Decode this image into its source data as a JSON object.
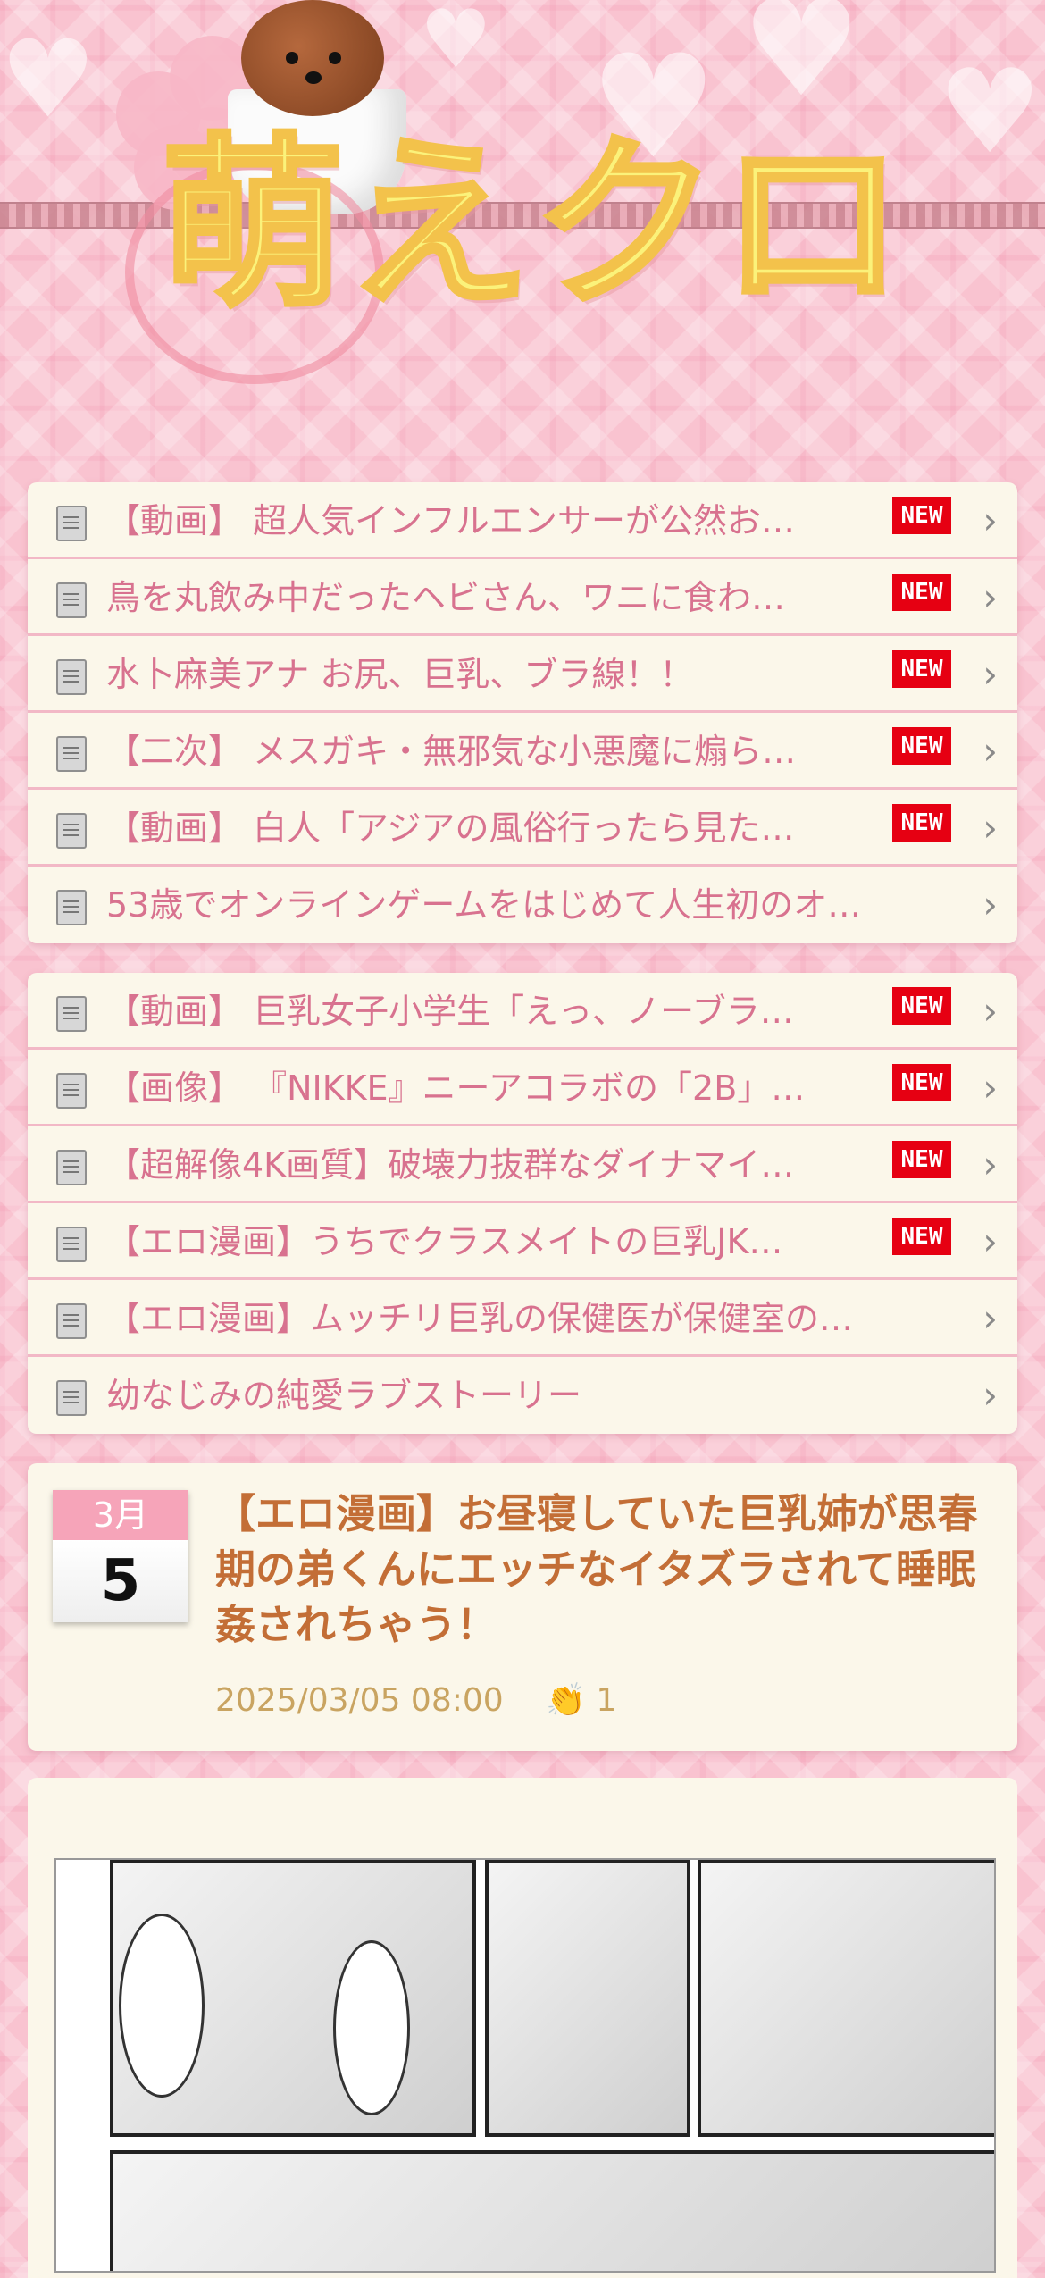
{
  "header": {
    "logo_text": "萌えクロ"
  },
  "list1": [
    {
      "title": "【動画】 超人気インフルエンサーが公然お…",
      "new": true
    },
    {
      "title": "鳥を丸飲み中だったヘビさん、ワニに食わ…",
      "new": true
    },
    {
      "title": "水卜麻美アナ お尻、巨乳、ブラ線！！",
      "new": true
    },
    {
      "title": "【二次】 メスガキ・無邪気な小悪魔に煽ら…",
      "new": true
    },
    {
      "title": "【動画】 白人「アジアの風俗行ったら見た…",
      "new": true
    },
    {
      "title": "53歳でオンラインゲームをはじめて人生初のオ…",
      "new": false
    }
  ],
  "list2": [
    {
      "title": "【動画】 巨乳女子小学生「えっ、ノーブラ…",
      "new": true
    },
    {
      "title": "【画像】 『NIKKE』ニーアコラボの「2B」…",
      "new": true
    },
    {
      "title": "【超解像4K画質】破壊力抜群なダイナマイ…",
      "new": true
    },
    {
      "title": "【エロ漫画】うちでクラスメイトの巨乳JK…",
      "new": true
    },
    {
      "title": "【エロ漫画】ムッチリ巨乳の保健医が保健室の…",
      "new": false
    },
    {
      "title": "幼なじみの純愛ラブストーリー",
      "new": false
    }
  ],
  "new_badge": "NEW",
  "article": {
    "month": "3月",
    "day": "5",
    "title": "【エロ漫画】お昼寝していた巨乳姉が思春期の弟くんにエッチなイタズラされて睡眠姦されちゃう！",
    "datetime": "2025/03/05 08:00",
    "claps": "1"
  }
}
